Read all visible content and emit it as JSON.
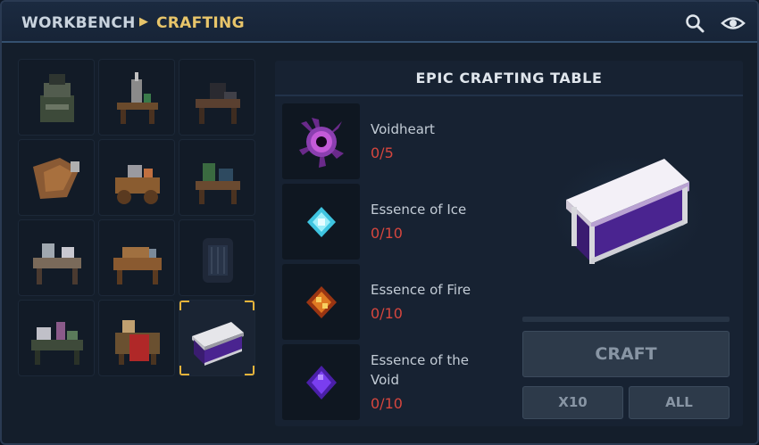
{
  "header": {
    "breadcrumb_root": "WORKBENCH",
    "breadcrumb_current": "CRAFTING",
    "separator_icon": "triangle-right-icon",
    "search_icon": "search-icon",
    "visibility_icon": "eye-icon"
  },
  "workbench_grid": {
    "items": [
      {
        "name": "stone-forge-bench"
      },
      {
        "name": "alchemy-workbench"
      },
      {
        "name": "anvil-bench"
      },
      {
        "name": "tannery-bench"
      },
      {
        "name": "cooking-cart-bench"
      },
      {
        "name": "farming-bench"
      },
      {
        "name": "sewing-bench"
      },
      {
        "name": "carpentry-bench"
      },
      {
        "name": "arcane-cabinet-bench"
      },
      {
        "name": "chemistry-bench"
      },
      {
        "name": "fabric-loom-bench"
      },
      {
        "name": "epic-crafting-table",
        "selected": true
      }
    ]
  },
  "recipe": {
    "title": "EPIC CRAFTING TABLE",
    "ingredients": [
      {
        "name": "Voidheart",
        "count": "0/5",
        "icon": "voidheart-icon"
      },
      {
        "name": "Essence of Ice",
        "count": "0/10",
        "icon": "ice-essence-icon"
      },
      {
        "name": "Essence of Fire",
        "count": "0/10",
        "icon": "fire-essence-icon"
      },
      {
        "name": "Essence of the Void",
        "count": "0/10",
        "icon": "void-essence-icon"
      }
    ],
    "progress": 0,
    "craft_label": "CRAFT",
    "x10_label": "X10",
    "all_label": "ALL"
  },
  "colors": {
    "accent_gold": "#e8c56a",
    "missing_count_red": "#d6463e",
    "panel_bg": "#172232"
  }
}
